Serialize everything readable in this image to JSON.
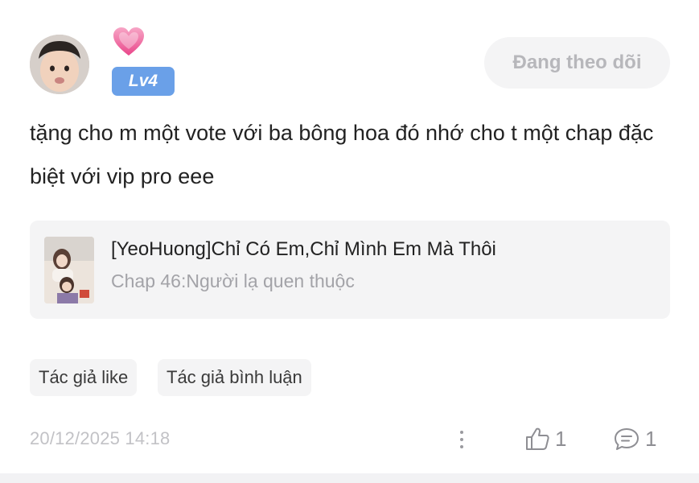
{
  "user": {
    "level_badge": "Lv4",
    "follow_button_label": "Đang theo dõi"
  },
  "comment": {
    "text": "tặng cho m một vote với ba bông hoa đó nhớ cho t một chap đặc biệt với vip pro eee"
  },
  "book": {
    "title": "[YeoHuong]Chỉ Có Em,Chỉ Mình Em Mà Thôi",
    "chapter": "Chap 46:Người lạ quen thuộc"
  },
  "tags": [
    "Tác giả like",
    "Tác giả bình luận"
  ],
  "footer": {
    "timestamp": "20/12/2025 14:18",
    "like_count": "1",
    "comment_count": "1"
  },
  "colors": {
    "level_badge_bg": "#6aa0e8",
    "follow_button_bg": "#f4f4f5",
    "heart": "#f06ea0"
  },
  "icons": [
    "heart-icon",
    "more-options-icon",
    "like-icon",
    "comment-icon"
  ]
}
